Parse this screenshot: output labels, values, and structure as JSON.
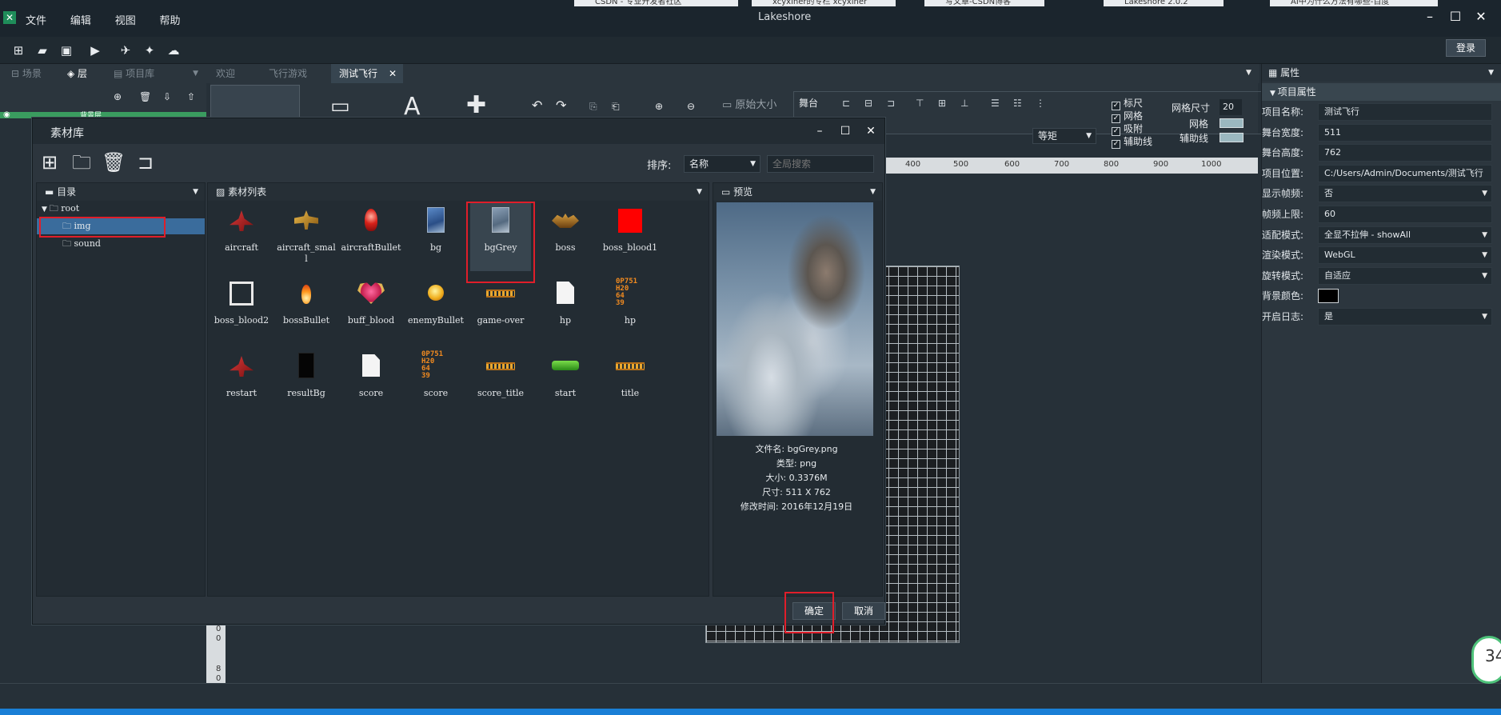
{
  "window": {
    "title": "Lakeshore",
    "menu": [
      "文件",
      "编辑",
      "视图",
      "帮助"
    ],
    "login": "登录"
  },
  "browser_tabs": [
    "CSDN - 专业开发者社区",
    "xcyxiner的专栏 xcyxiner",
    "写文章-CSDN博客",
    "Lakeshore 2.0.2",
    "AI中为什么方法有哪些-百度"
  ],
  "left_tabs": [
    "场景",
    "层",
    "项目库"
  ],
  "doc_tabs": {
    "items": [
      "欢迎",
      "飞行游戏",
      "测试飞行"
    ],
    "active": 2
  },
  "layer_row": "背景层",
  "ribbon": {
    "original_size": "原始大小",
    "stage": "舞台",
    "spacing": "等矩",
    "checks": [
      "标尺",
      "网格",
      "吸附",
      "辅助线"
    ],
    "grid_size_label": "网格尺寸",
    "grid_size_value": "20",
    "grid_label": "网格",
    "guide_label": "辅助线"
  },
  "ruler_marks": [
    "400",
    "500",
    "600",
    "700",
    "800",
    "900",
    "1000"
  ],
  "vruler_marks": [
    "0",
    "0",
    "8",
    "0"
  ],
  "props": {
    "header": "属性",
    "section": "项目属性",
    "rows": [
      {
        "label": "项目名称:",
        "value": "测试飞行",
        "dropdown": false
      },
      {
        "label": "舞台宽度:",
        "value": "511",
        "dropdown": false
      },
      {
        "label": "舞台高度:",
        "value": "762",
        "dropdown": false
      },
      {
        "label": "项目位置:",
        "value": "C:/Users/Admin/Documents/测试飞行",
        "dropdown": false
      },
      {
        "label": "显示帧频:",
        "value": "否",
        "dropdown": true
      },
      {
        "label": "帧频上限:",
        "value": "60",
        "dropdown": false
      },
      {
        "label": "适配模式:",
        "value": "全显不拉伸 - showAll",
        "dropdown": true
      },
      {
        "label": "渲染模式:",
        "value": "WebGL",
        "dropdown": true
      },
      {
        "label": "旋转模式:",
        "value": "自适应",
        "dropdown": true
      },
      {
        "label": "背景颜色:",
        "value": "",
        "dropdown": false
      },
      {
        "label": "开启日志:",
        "value": "是",
        "dropdown": true
      }
    ]
  },
  "dialog": {
    "title": "素材库",
    "sort_label": "排序:",
    "sort_value": "名称",
    "search_placeholder": "全局搜索",
    "dir_header": "目录",
    "list_header": "素材列表",
    "preview_header": "预览",
    "tree": [
      "root",
      "img",
      "sound"
    ],
    "assets": [
      {
        "name": "aircraft",
        "icon": "plane-red"
      },
      {
        "name": "aircraft_small",
        "icon": "plane-gold"
      },
      {
        "name": "aircraftBullet",
        "icon": "bullet-red"
      },
      {
        "name": "bg",
        "icon": "image-blue"
      },
      {
        "name": "bgGrey",
        "icon": "image-grey"
      },
      {
        "name": "boss",
        "icon": "boss-gold"
      },
      {
        "name": "boss_blood1",
        "icon": "red-square"
      },
      {
        "name": "boss_blood2",
        "icon": "white-frame"
      },
      {
        "name": "bossBullet",
        "icon": "flame"
      },
      {
        "name": "buff_blood",
        "icon": "heart"
      },
      {
        "name": "enemyBullet",
        "icon": "orb"
      },
      {
        "name": "game-over",
        "icon": "text-gold"
      },
      {
        "name": "hp",
        "icon": "file-white"
      },
      {
        "name": "hp",
        "icon": "digits-orange"
      },
      {
        "name": "restart",
        "icon": "plane-red"
      },
      {
        "name": "resultBg",
        "icon": "black-rect"
      },
      {
        "name": "score",
        "icon": "file-white"
      },
      {
        "name": "score",
        "icon": "digits-orange"
      },
      {
        "name": "score_title",
        "icon": "text-gold"
      },
      {
        "name": "start",
        "icon": "green-button"
      },
      {
        "name": "title",
        "icon": "text-gold"
      }
    ],
    "selected_asset": "bgGrey",
    "preview_info": [
      "文件名: bgGrey.png",
      "类型: png",
      "大小: 0.3376M",
      "尺寸: 511 X 762",
      "修改时间: 2016年12月19日"
    ],
    "ok": "确定",
    "cancel": "取消"
  },
  "clock": "34",
  "colors": {
    "accent": "#3a7bb3",
    "highlight": "#e01e2a",
    "grid_swatch": "#9bb8c0"
  }
}
